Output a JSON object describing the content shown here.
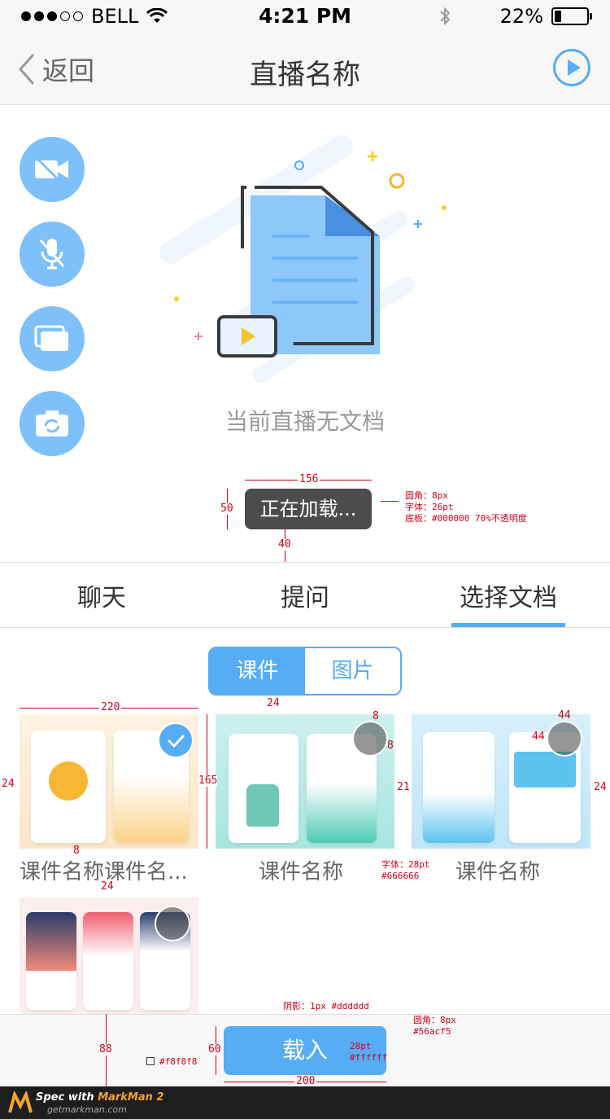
{
  "status_bar": {
    "carrier": "BELL",
    "time": "4:21 PM",
    "battery": "22%"
  },
  "nav": {
    "back_label": "返回",
    "title": "直播名称"
  },
  "empty_state": {
    "text": "当前直播无文档",
    "loading_text": "正在加载..."
  },
  "tabs": [
    {
      "label": "聊天"
    },
    {
      "label": "提问"
    },
    {
      "label": "选择文档"
    }
  ],
  "segment": {
    "courseware": "课件",
    "images": "图片"
  },
  "thumbnails": [
    {
      "caption": "课件名称课件名...",
      "selected": true
    },
    {
      "caption": "课件名称",
      "selected": false
    },
    {
      "caption": "课件名称",
      "selected": false
    },
    {
      "caption": "",
      "selected": false
    }
  ],
  "load_button": "载入",
  "annotations": {
    "width_156": "156",
    "height_50": "50",
    "gap_40": "40",
    "loading_spec": [
      "圆角：8px",
      "字体：26pt",
      "底板：#000000 70%不透明度"
    ],
    "width_220": "220",
    "gap_24_top": "24",
    "height_165": "165",
    "side_24_left": "24",
    "side_24_right": "24",
    "gap_21": "21",
    "gap_8": "8",
    "gap_8_b": "8",
    "gap_8_c": "8",
    "size_44_w": "44",
    "size_44_h": "44",
    "gap_24_mid": "24",
    "caption_spec": [
      "字体：28pt",
      "#666666"
    ],
    "shadow_spec": "阴影：1px #dddddd",
    "btn_spec": [
      "圆角：8px",
      "#56acf5"
    ],
    "height_88": "88",
    "height_60": "60",
    "width_200": "200",
    "btn_font_spec": [
      "28pt",
      "#ffffff"
    ],
    "bg_color": "#f8f8f8"
  },
  "footer": {
    "brand_prefix": "Spec with",
    "brand": "MarkMan 2",
    "url": "getmarkman.com"
  },
  "colors": {
    "accent": "#56acf5",
    "light_accent": "#7dc0fa",
    "text": "#333333",
    "caption": "#666666",
    "annotation": "#d0021b"
  }
}
